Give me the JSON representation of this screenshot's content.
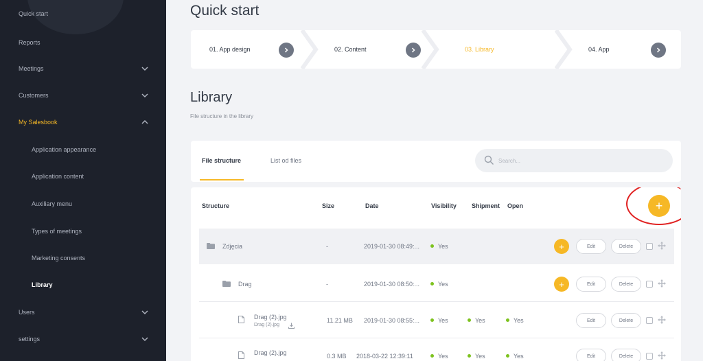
{
  "sidebar": {
    "items": [
      {
        "label": "Quick start"
      },
      {
        "label": "Reports"
      },
      {
        "label": "Meetings"
      },
      {
        "label": "Customers"
      },
      {
        "label": "My Salesbook"
      },
      {
        "label": "Application appearance"
      },
      {
        "label": "Application content"
      },
      {
        "label": "Auxiliary menu"
      },
      {
        "label": "Types of meetings"
      },
      {
        "label": "Marketing consents"
      },
      {
        "label": "Library"
      },
      {
        "label": "Users"
      },
      {
        "label": "settings"
      }
    ]
  },
  "page": {
    "title": "Quick start"
  },
  "steps": [
    {
      "label": "01. App design"
    },
    {
      "label": "02. Content"
    },
    {
      "label": "03. Library"
    },
    {
      "label": "04. App"
    }
  ],
  "section": {
    "title": "Library",
    "subtitle": "File structure in the library"
  },
  "tabs": [
    {
      "label": "File structure"
    },
    {
      "label": "List od files"
    }
  ],
  "search": {
    "placeholder": "Search..."
  },
  "table": {
    "headers": {
      "structure": "Structure",
      "size": "Size",
      "date": "Date",
      "visibility": "Visibility",
      "shipment": "Shipment",
      "open": "Open"
    },
    "add_label": "+",
    "edit_label": "Edit",
    "delete_label": "Delete",
    "rows": [
      {
        "name": "Zdjęcia",
        "size": "-",
        "date": "2019-01-30 08:49:...",
        "visibility": "Yes"
      },
      {
        "name": "Drag",
        "size": "-",
        "date": "2019-01-30 08:50:...",
        "visibility": "Yes"
      },
      {
        "name": "Drag (2).jpg",
        "sub": "Drag (2).jpg",
        "size": "11.21 MB",
        "date": "2019-01-30 08:55:...",
        "visibility": "Yes",
        "shipment": "Yes",
        "open": "Yes"
      },
      {
        "name": "Drag (2).jpg",
        "size": "0.3 MB",
        "date": "2018-03-22 12:39:11",
        "visibility": "Yes",
        "shipment": "Yes",
        "open": "Yes"
      }
    ]
  },
  "colors": {
    "accent": "#f6b826",
    "sidebar_bg": "#1d212b",
    "highlight_circle": "#e02020",
    "status_dot": "#7dc21e"
  }
}
